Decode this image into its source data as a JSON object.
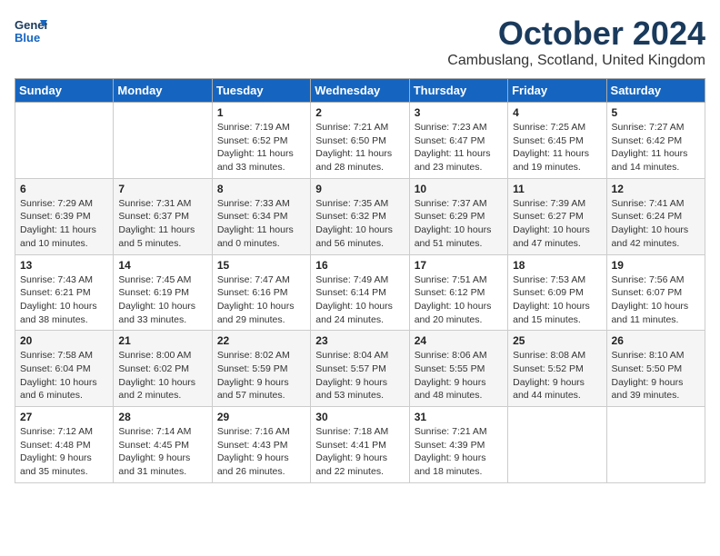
{
  "logo": {
    "line1": "General",
    "line2": "Blue"
  },
  "title": "October 2024",
  "subtitle": "Cambuslang, Scotland, United Kingdom",
  "days_of_week": [
    "Sunday",
    "Monday",
    "Tuesday",
    "Wednesday",
    "Thursday",
    "Friday",
    "Saturday"
  ],
  "weeks": [
    [
      {
        "num": "",
        "info": ""
      },
      {
        "num": "",
        "info": ""
      },
      {
        "num": "1",
        "info": "Sunrise: 7:19 AM\nSunset: 6:52 PM\nDaylight: 11 hours\nand 33 minutes."
      },
      {
        "num": "2",
        "info": "Sunrise: 7:21 AM\nSunset: 6:50 PM\nDaylight: 11 hours\nand 28 minutes."
      },
      {
        "num": "3",
        "info": "Sunrise: 7:23 AM\nSunset: 6:47 PM\nDaylight: 11 hours\nand 23 minutes."
      },
      {
        "num": "4",
        "info": "Sunrise: 7:25 AM\nSunset: 6:45 PM\nDaylight: 11 hours\nand 19 minutes."
      },
      {
        "num": "5",
        "info": "Sunrise: 7:27 AM\nSunset: 6:42 PM\nDaylight: 11 hours\nand 14 minutes."
      }
    ],
    [
      {
        "num": "6",
        "info": "Sunrise: 7:29 AM\nSunset: 6:39 PM\nDaylight: 11 hours\nand 10 minutes."
      },
      {
        "num": "7",
        "info": "Sunrise: 7:31 AM\nSunset: 6:37 PM\nDaylight: 11 hours\nand 5 minutes."
      },
      {
        "num": "8",
        "info": "Sunrise: 7:33 AM\nSunset: 6:34 PM\nDaylight: 11 hours\nand 0 minutes."
      },
      {
        "num": "9",
        "info": "Sunrise: 7:35 AM\nSunset: 6:32 PM\nDaylight: 10 hours\nand 56 minutes."
      },
      {
        "num": "10",
        "info": "Sunrise: 7:37 AM\nSunset: 6:29 PM\nDaylight: 10 hours\nand 51 minutes."
      },
      {
        "num": "11",
        "info": "Sunrise: 7:39 AM\nSunset: 6:27 PM\nDaylight: 10 hours\nand 47 minutes."
      },
      {
        "num": "12",
        "info": "Sunrise: 7:41 AM\nSunset: 6:24 PM\nDaylight: 10 hours\nand 42 minutes."
      }
    ],
    [
      {
        "num": "13",
        "info": "Sunrise: 7:43 AM\nSunset: 6:21 PM\nDaylight: 10 hours\nand 38 minutes."
      },
      {
        "num": "14",
        "info": "Sunrise: 7:45 AM\nSunset: 6:19 PM\nDaylight: 10 hours\nand 33 minutes."
      },
      {
        "num": "15",
        "info": "Sunrise: 7:47 AM\nSunset: 6:16 PM\nDaylight: 10 hours\nand 29 minutes."
      },
      {
        "num": "16",
        "info": "Sunrise: 7:49 AM\nSunset: 6:14 PM\nDaylight: 10 hours\nand 24 minutes."
      },
      {
        "num": "17",
        "info": "Sunrise: 7:51 AM\nSunset: 6:12 PM\nDaylight: 10 hours\nand 20 minutes."
      },
      {
        "num": "18",
        "info": "Sunrise: 7:53 AM\nSunset: 6:09 PM\nDaylight: 10 hours\nand 15 minutes."
      },
      {
        "num": "19",
        "info": "Sunrise: 7:56 AM\nSunset: 6:07 PM\nDaylight: 10 hours\nand 11 minutes."
      }
    ],
    [
      {
        "num": "20",
        "info": "Sunrise: 7:58 AM\nSunset: 6:04 PM\nDaylight: 10 hours\nand 6 minutes."
      },
      {
        "num": "21",
        "info": "Sunrise: 8:00 AM\nSunset: 6:02 PM\nDaylight: 10 hours\nand 2 minutes."
      },
      {
        "num": "22",
        "info": "Sunrise: 8:02 AM\nSunset: 5:59 PM\nDaylight: 9 hours\nand 57 minutes."
      },
      {
        "num": "23",
        "info": "Sunrise: 8:04 AM\nSunset: 5:57 PM\nDaylight: 9 hours\nand 53 minutes."
      },
      {
        "num": "24",
        "info": "Sunrise: 8:06 AM\nSunset: 5:55 PM\nDaylight: 9 hours\nand 48 minutes."
      },
      {
        "num": "25",
        "info": "Sunrise: 8:08 AM\nSunset: 5:52 PM\nDaylight: 9 hours\nand 44 minutes."
      },
      {
        "num": "26",
        "info": "Sunrise: 8:10 AM\nSunset: 5:50 PM\nDaylight: 9 hours\nand 39 minutes."
      }
    ],
    [
      {
        "num": "27",
        "info": "Sunrise: 7:12 AM\nSunset: 4:48 PM\nDaylight: 9 hours\nand 35 minutes."
      },
      {
        "num": "28",
        "info": "Sunrise: 7:14 AM\nSunset: 4:45 PM\nDaylight: 9 hours\nand 31 minutes."
      },
      {
        "num": "29",
        "info": "Sunrise: 7:16 AM\nSunset: 4:43 PM\nDaylight: 9 hours\nand 26 minutes."
      },
      {
        "num": "30",
        "info": "Sunrise: 7:18 AM\nSunset: 4:41 PM\nDaylight: 9 hours\nand 22 minutes."
      },
      {
        "num": "31",
        "info": "Sunrise: 7:21 AM\nSunset: 4:39 PM\nDaylight: 9 hours\nand 18 minutes."
      },
      {
        "num": "",
        "info": ""
      },
      {
        "num": "",
        "info": ""
      }
    ]
  ]
}
